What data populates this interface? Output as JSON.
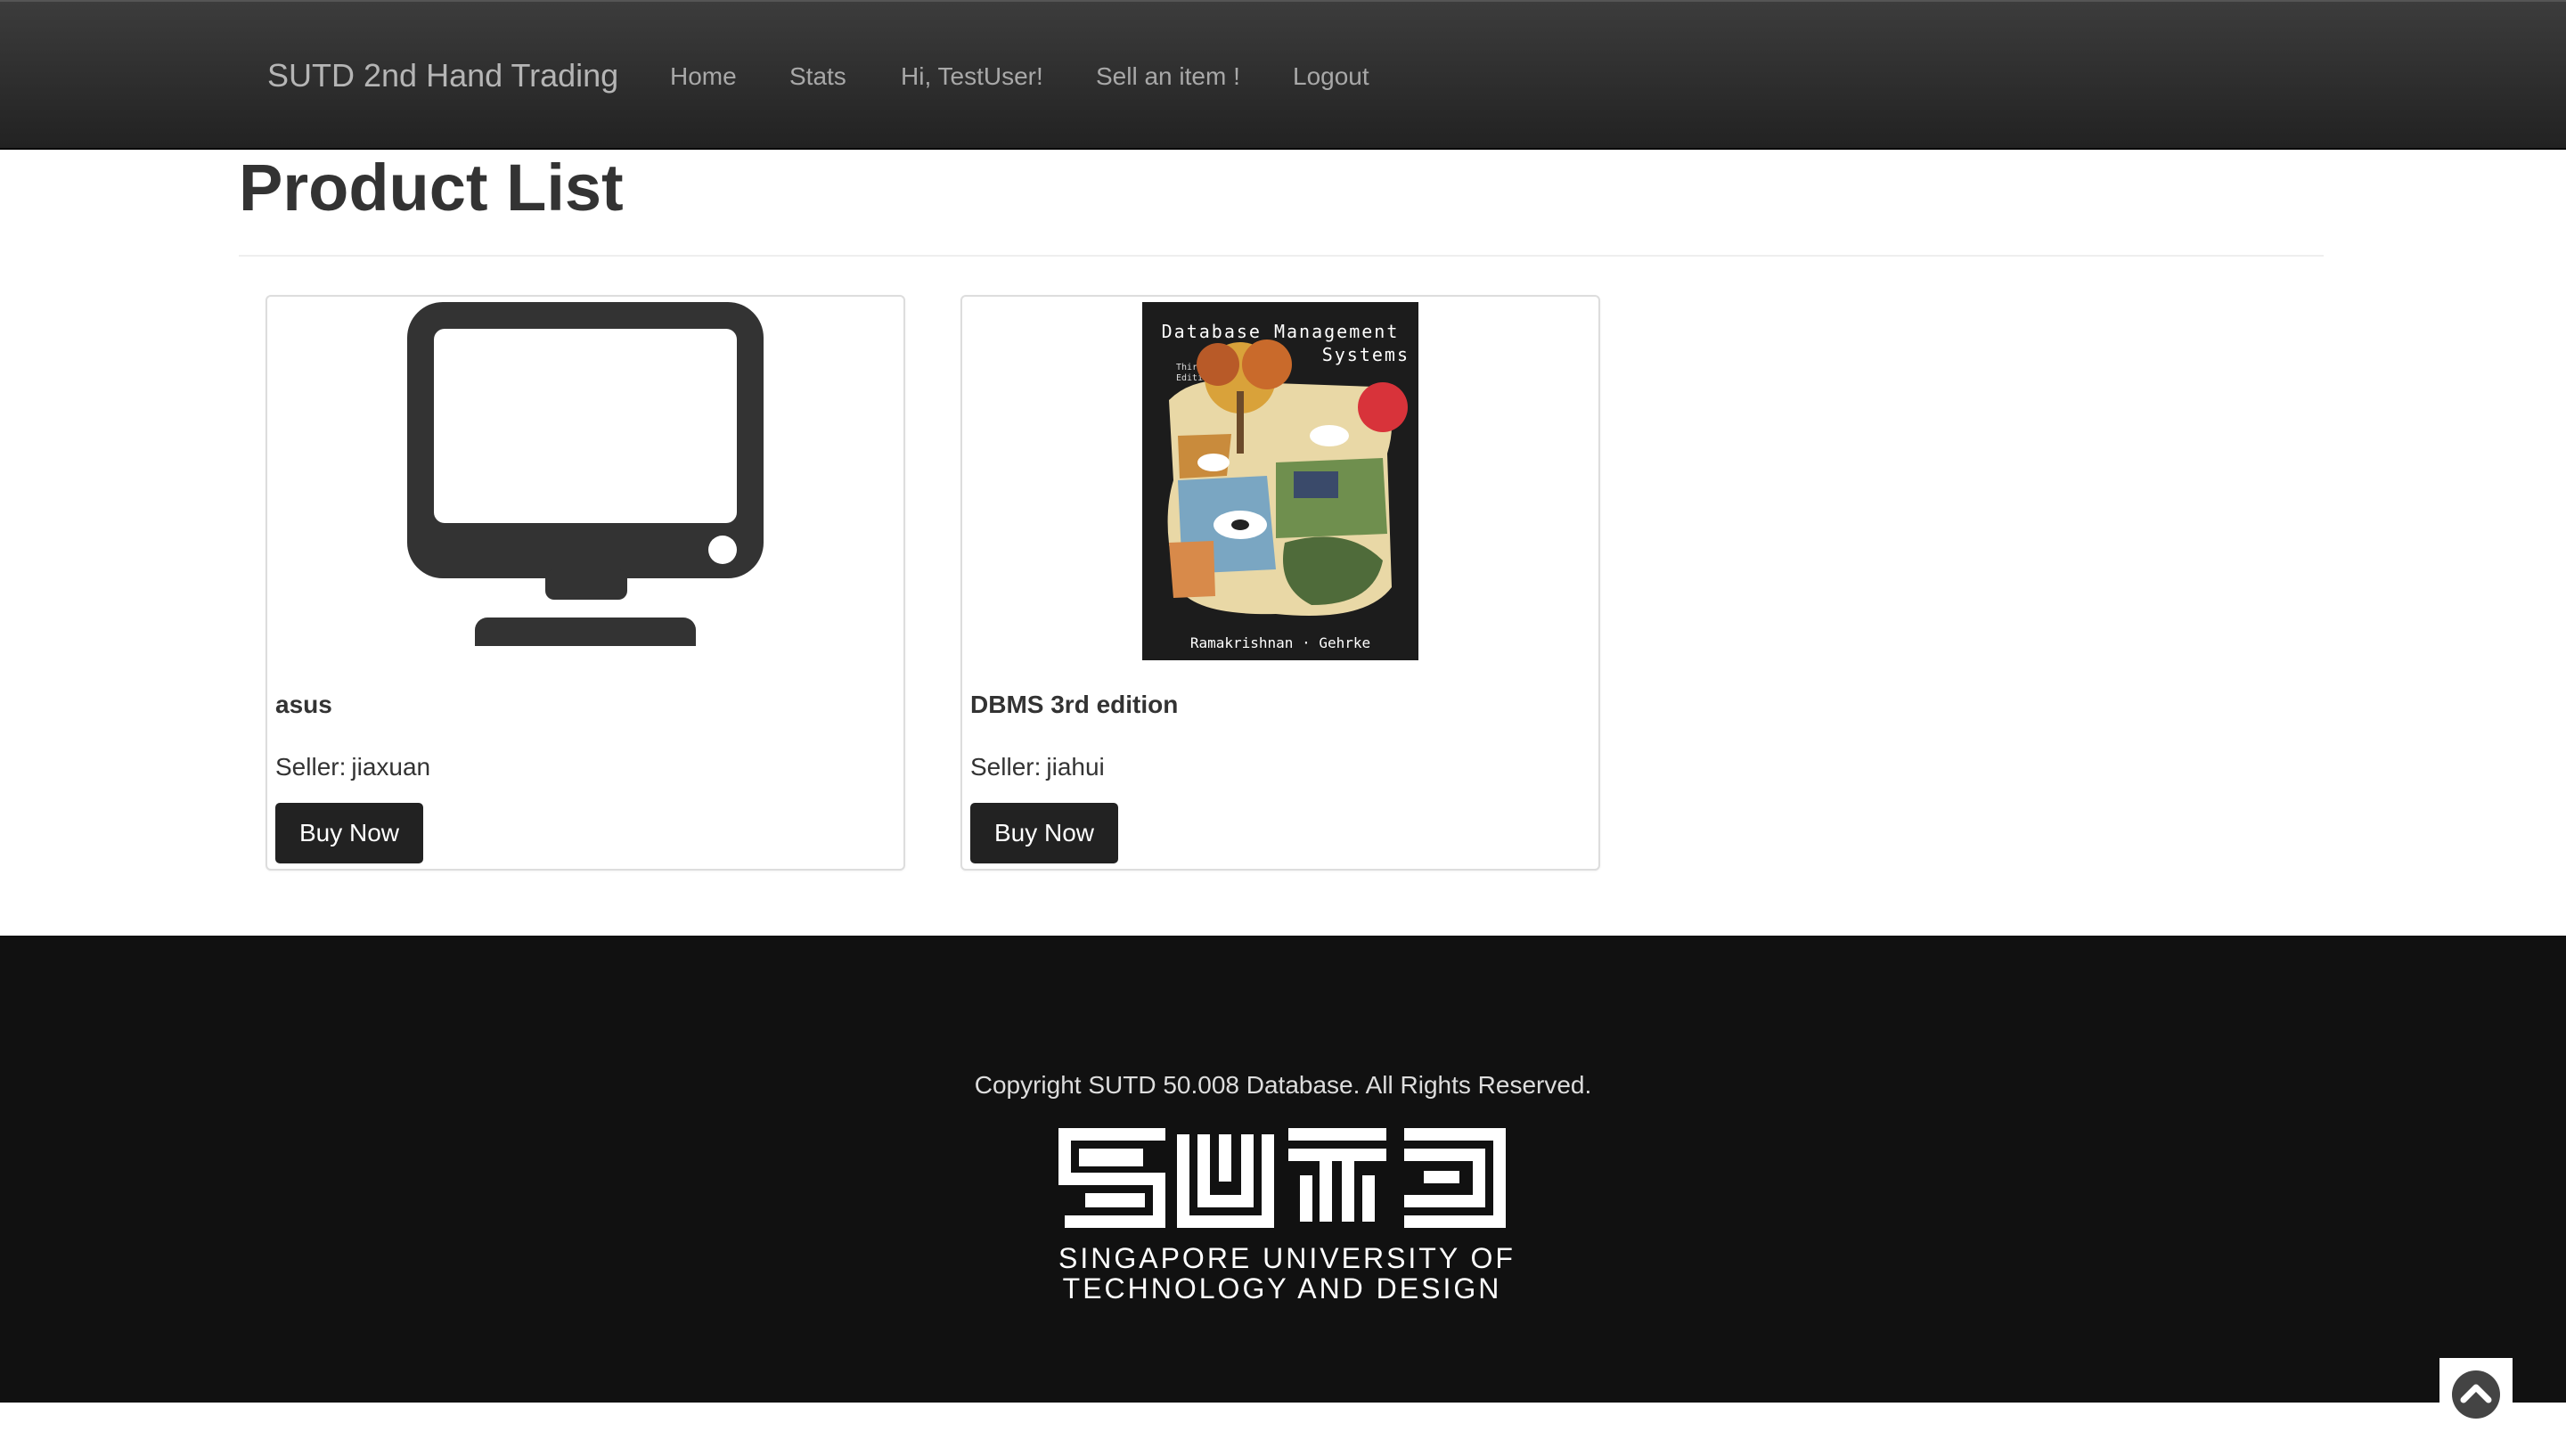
{
  "navbar": {
    "brand": "SUTD 2nd Hand Trading",
    "links": [
      {
        "label": "Home"
      },
      {
        "label": "Stats"
      },
      {
        "label": "Hi, TestUser!"
      },
      {
        "label": "Sell an item !"
      },
      {
        "label": "Logout"
      }
    ]
  },
  "main": {
    "title": "Product List",
    "products": [
      {
        "name": "asus",
        "seller_label": "Seller:",
        "seller": "jiaxuan",
        "buy_label": "Buy Now",
        "image_icon": "monitor-icon"
      },
      {
        "name": "DBMS 3rd edition",
        "seller_label": "Seller:",
        "seller": "jiahui",
        "buy_label": "Buy Now",
        "image_icon": "book-cover-image",
        "cover": {
          "title_line1": "Database Management",
          "title_line2": "Systems",
          "edition_line1": "Third",
          "edition_line2": "Edition",
          "authors": "Ramakrishnan · Gehrke"
        }
      }
    ]
  },
  "footer": {
    "copyright": "Copyright SUTD 50.008 Database. All Rights Reserved.",
    "logo_line1": "SINGAPORE UNIVERSITY OF",
    "logo_line2": "TECHNOLOGY AND DESIGN"
  },
  "colors": {
    "navbar": "#222222",
    "footer": "#111111",
    "button": "#222222",
    "nav_text": "#a8a8a8"
  },
  "icons": {
    "scroll_top": "chevron-up-circle-icon"
  }
}
